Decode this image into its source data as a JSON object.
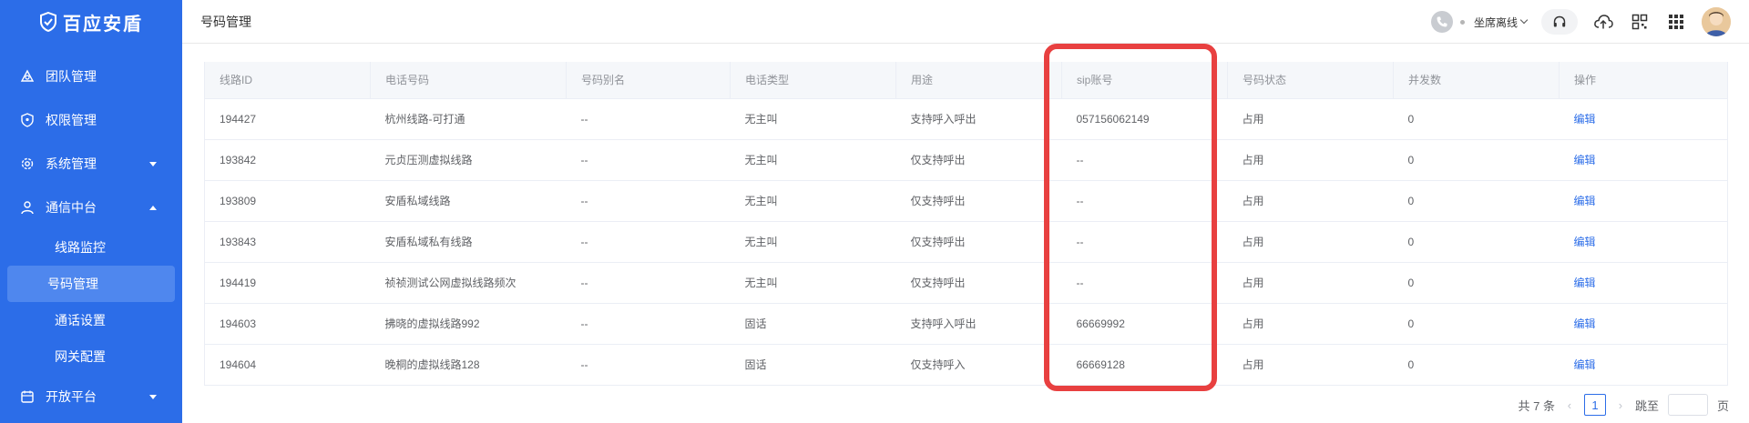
{
  "brand": {
    "name": "百应安盾"
  },
  "sidebar": {
    "items": [
      {
        "label": "团队管理",
        "icon": "team-icon"
      },
      {
        "label": "权限管理",
        "icon": "shield-icon"
      },
      {
        "label": "系统管理",
        "icon": "gear-icon",
        "expandable": true
      },
      {
        "label": "通信中台",
        "icon": "user-icon",
        "expanded": true,
        "children": [
          {
            "label": "线路监控"
          },
          {
            "label": "号码管理",
            "active": true
          },
          {
            "label": "通话设置"
          },
          {
            "label": "网关配置"
          }
        ]
      },
      {
        "label": "开放平台",
        "icon": "calendar-icon",
        "expandable": true
      }
    ]
  },
  "header": {
    "title": "号码管理",
    "agent_status": "坐席离线"
  },
  "table": {
    "columns": [
      "线路ID",
      "电话号码",
      "号码别名",
      "电话类型",
      "用途",
      "sip账号",
      "号码状态",
      "并发数",
      "操作"
    ],
    "rows": [
      [
        "194427",
        "杭州线路-可打通",
        "--",
        "无主叫",
        "支持呼入呼出",
        "057156062149",
        "占用",
        "0",
        "编辑"
      ],
      [
        "193842",
        "元贞压测虚拟线路",
        "--",
        "无主叫",
        "仅支持呼出",
        "--",
        "占用",
        "0",
        "编辑"
      ],
      [
        "193809",
        "安盾私域线路",
        "--",
        "无主叫",
        "仅支持呼出",
        "--",
        "占用",
        "0",
        "编辑"
      ],
      [
        "193843",
        "安盾私域私有线路",
        "--",
        "无主叫",
        "仅支持呼出",
        "--",
        "占用",
        "0",
        "编辑"
      ],
      [
        "194419",
        "祯祯测试公网虚拟线路频次",
        "--",
        "无主叫",
        "仅支持呼出",
        "--",
        "占用",
        "0",
        "编辑"
      ],
      [
        "194603",
        "拂晓的虚拟线路992",
        "--",
        "固话",
        "支持呼入呼出",
        "66669992",
        "占用",
        "0",
        "编辑"
      ],
      [
        "194604",
        "晚桐的虚拟线路128",
        "--",
        "固话",
        "仅支持呼入",
        "66669128",
        "占用",
        "0",
        "编辑"
      ]
    ]
  },
  "pagination": {
    "total": "共 7 条",
    "current_page": "1",
    "jump_label": "跳至",
    "page_suffix": "页"
  },
  "colors": {
    "sidebar": "#2c6de8",
    "highlight": "#e84040",
    "link": "#2c6de8"
  }
}
